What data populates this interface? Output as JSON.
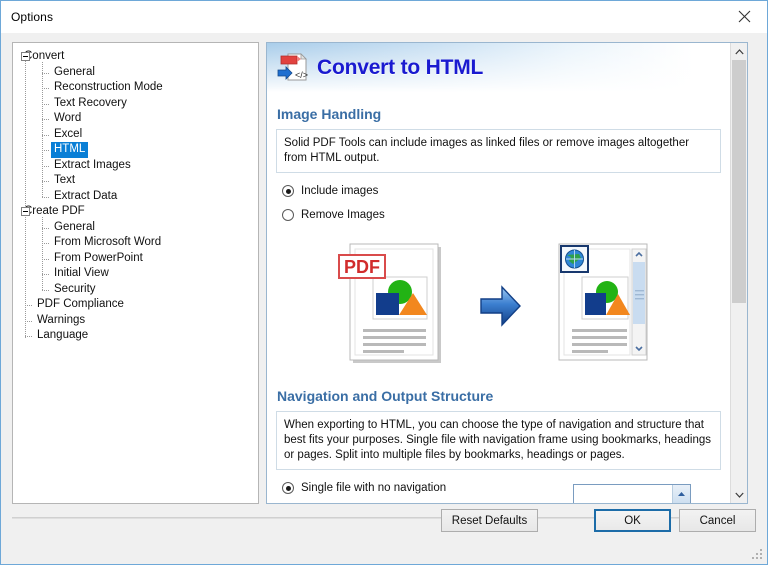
{
  "window": {
    "title": "Options",
    "close_icon": "close-icon"
  },
  "tree": {
    "items": [
      {
        "label": "Convert",
        "level": 0,
        "expander": true,
        "selected": false
      },
      {
        "label": "General",
        "level": 1,
        "expander": false,
        "selected": false
      },
      {
        "label": "Reconstruction Mode",
        "level": 1,
        "expander": false,
        "selected": false
      },
      {
        "label": "Text Recovery",
        "level": 1,
        "expander": false,
        "selected": false
      },
      {
        "label": "Word",
        "level": 1,
        "expander": false,
        "selected": false
      },
      {
        "label": "Excel",
        "level": 1,
        "expander": false,
        "selected": false
      },
      {
        "label": "HTML",
        "level": 1,
        "expander": false,
        "selected": true
      },
      {
        "label": "Extract Images",
        "level": 1,
        "expander": false,
        "selected": false
      },
      {
        "label": "Text",
        "level": 1,
        "expander": false,
        "selected": false
      },
      {
        "label": "Extract Data",
        "level": 1,
        "expander": false,
        "selected": false
      },
      {
        "label": "Create PDF",
        "level": 0,
        "expander": true,
        "selected": false
      },
      {
        "label": "General",
        "level": 1,
        "expander": false,
        "selected": false
      },
      {
        "label": "From Microsoft Word",
        "level": 1,
        "expander": false,
        "selected": false
      },
      {
        "label": "From PowerPoint",
        "level": 1,
        "expander": false,
        "selected": false
      },
      {
        "label": "Initial View",
        "level": 1,
        "expander": false,
        "selected": false
      },
      {
        "label": "Security",
        "level": 1,
        "expander": false,
        "selected": false
      },
      {
        "label": "PDF Compliance",
        "level": 2,
        "expander": false,
        "selected": false
      },
      {
        "label": "Warnings",
        "level": 2,
        "expander": false,
        "selected": false
      },
      {
        "label": "Language",
        "level": 2,
        "expander": false,
        "selected": false
      }
    ]
  },
  "panel": {
    "header": {
      "title": "Convert to HTML",
      "icon": "convert-to-html-icon",
      "title_color": "#1a1ad0"
    },
    "sections": [
      {
        "id": "image-handling",
        "title": "Image Handling",
        "description": "Solid PDF Tools can include images as linked files or remove images altogether from HTML output.",
        "options": [
          {
            "label": "Include images",
            "selected": true
          },
          {
            "label": "Remove Images",
            "selected": false
          }
        ]
      },
      {
        "id": "navigation-and-output-structure",
        "title": "Navigation and Output Structure",
        "description": "When exporting to HTML, you can choose the type of navigation and structure that best fits your purposes. Single file with navigation frame using bookmarks, headings or pages. Split into multiple files by bookmarks, headings or pages.",
        "options": [
          {
            "label": "Single file with no navigation",
            "selected": true
          }
        ]
      }
    ],
    "illustration": {
      "source_badge": "PDF",
      "source_doc": "pdf-document-icon",
      "arrow": "right-arrow-icon",
      "target_doc": "html-document-icon",
      "target_badge": "globe-icon"
    },
    "scrollbar": {
      "up_icon": "chevron-up-icon",
      "down_icon": "chevron-down-icon"
    },
    "combobox": {
      "value": "",
      "arrow_icon": "chevron-up-icon"
    },
    "heading_color": "#3a6ea5"
  },
  "footer": {
    "reset_label": "Reset Defaults",
    "ok_label": "OK",
    "cancel_label": "Cancel",
    "focus_color": "#1c6ca8"
  }
}
